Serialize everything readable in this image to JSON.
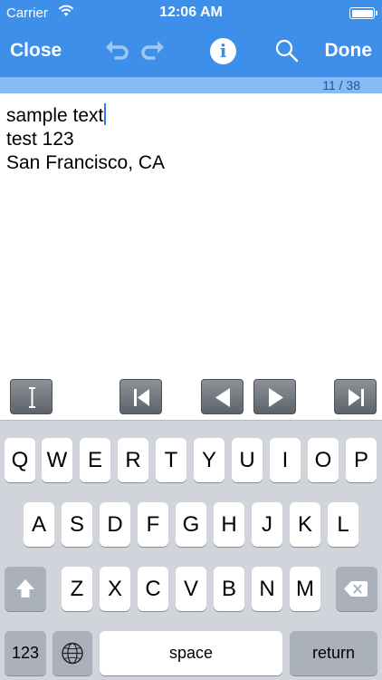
{
  "status_bar": {
    "carrier": "Carrier",
    "time": "12:06 AM",
    "battery_level": 1.0
  },
  "nav": {
    "close_label": "Close",
    "done_label": "Done",
    "undo_icon": "undo-icon",
    "redo_icon": "redo-icon",
    "info_glyph": "i",
    "search_icon": "search-icon"
  },
  "position": {
    "label": "11 / 38"
  },
  "editor": {
    "lines": [
      "sample text",
      "test 123",
      "San Francisco, CA"
    ]
  },
  "toolbar": {
    "buttons": [
      "text-cursor-icon",
      "skip-to-start-icon",
      "previous-icon",
      "next-icon",
      "skip-to-end-icon"
    ]
  },
  "keyboard": {
    "row1": [
      "Q",
      "W",
      "E",
      "R",
      "T",
      "Y",
      "U",
      "I",
      "O",
      "P"
    ],
    "row2": [
      "A",
      "S",
      "D",
      "F",
      "G",
      "H",
      "J",
      "K",
      "L"
    ],
    "row3": [
      "Z",
      "X",
      "C",
      "V",
      "B",
      "N",
      "M"
    ],
    "numbers_label": "123",
    "space_label": "space",
    "return_label": "return"
  },
  "colors": {
    "header": "#3d8fe9",
    "position_bar": "#84bbf3",
    "cursor": "#3478f6",
    "keyboard_bg": "#d1d5db"
  }
}
